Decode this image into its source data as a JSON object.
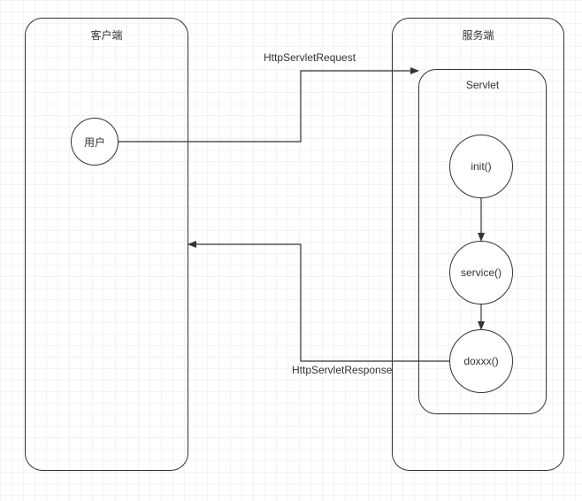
{
  "client": {
    "title": "客户端",
    "user": "用户"
  },
  "server": {
    "title": "服务端",
    "servlet": {
      "title": "Servlet",
      "init": "init()",
      "service": "service()",
      "doxxx": "doxxx()"
    }
  },
  "labels": {
    "request": "HttpServletRequest",
    "response": "HttpServletResponse"
  }
}
